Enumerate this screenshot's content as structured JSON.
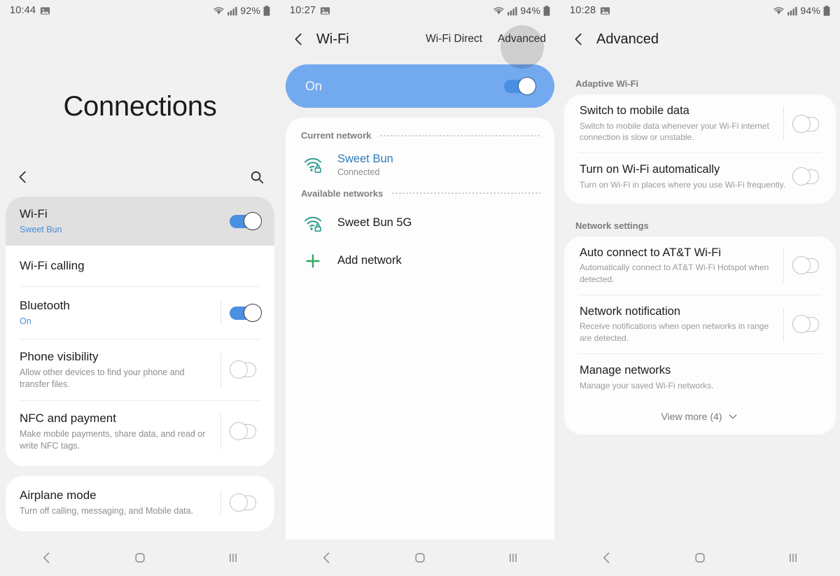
{
  "panels": {
    "left": {
      "status": {
        "time": "10:44",
        "battery": "92%",
        "icons": [
          "image-icon",
          "wifi-icon",
          "signal-icon",
          "battery-icon"
        ]
      },
      "page_title": "Connections",
      "tools": {
        "back": "back-chevron",
        "search": "search-icon"
      },
      "groups": [
        {
          "rows": [
            {
              "title": "Wi-Fi",
              "sub": "Sweet Bun",
              "sub_style": "blue",
              "toggle": "on",
              "selected": true,
              "divider_after": false
            },
            {
              "title": "Wi-Fi calling",
              "sub": "",
              "toggle": "none",
              "selected": false,
              "divider_after": true
            },
            {
              "title": "Bluetooth",
              "sub": "On",
              "sub_style": "blue",
              "toggle": "on",
              "selected": false,
              "divider_after": true
            },
            {
              "title": "Phone visibility",
              "sub": "Allow other devices to find your phone and transfer files.",
              "sub_style": "gray",
              "toggle": "off",
              "selected": false,
              "divider_after": true
            },
            {
              "title": "NFC and payment",
              "sub": "Make mobile payments, share data, and read or write NFC tags.",
              "sub_style": "gray",
              "toggle": "off",
              "selected": false,
              "divider_after": false
            }
          ]
        },
        {
          "rows": [
            {
              "title": "Airplane mode",
              "sub": "Turn off calling, messaging, and Mobile data.",
              "sub_style": "gray",
              "toggle": "off",
              "selected": false,
              "divider_after": false
            }
          ]
        }
      ],
      "navbar": [
        "back-nav-icon",
        "home-nav-icon",
        "recents-nav-icon"
      ]
    },
    "mid": {
      "status": {
        "time": "10:27",
        "battery": "94%"
      },
      "appbar": {
        "back": "back-chevron",
        "title": "Wi-Fi",
        "action1": "Wi-Fi Direct",
        "action2": "Advanced",
        "action2_pressed": true
      },
      "banner": {
        "label": "On",
        "toggle": "on"
      },
      "sections": [
        {
          "heading": "Current network",
          "items": [
            {
              "icon": "wifi-lock-icon",
              "title": "Sweet Bun",
              "sub": "Connected",
              "style": "linked"
            }
          ]
        },
        {
          "heading": "Available networks",
          "items": [
            {
              "icon": "wifi-lock-icon",
              "title": "Sweet Bun 5G",
              "sub": "",
              "style": "plain"
            },
            {
              "icon": "plus-icon",
              "title": "Add network",
              "sub": "",
              "style": "plain"
            }
          ]
        }
      ],
      "navbar": [
        "back-nav-icon",
        "home-nav-icon",
        "recents-nav-icon"
      ]
    },
    "right": {
      "status": {
        "time": "10:28",
        "battery": "94%"
      },
      "appbar": {
        "back": "back-chevron",
        "title": "Advanced"
      },
      "sections": [
        {
          "label": "Adaptive Wi-Fi",
          "rows": [
            {
              "title": "Switch to mobile data",
              "sub": "Switch to mobile data whenever your Wi-Fi internet connection is slow or unstable.",
              "toggle": "off",
              "divider_after": true
            },
            {
              "title": "Turn on Wi-Fi automatically",
              "sub": "Turn on Wi-Fi in places where you use Wi-Fi frequently.",
              "toggle": "off",
              "divider_after": false
            }
          ],
          "view_more": null
        },
        {
          "label": "Network settings",
          "rows": [
            {
              "title": "Auto connect to AT&T Wi-Fi",
              "sub": "Automatically connect to AT&T Wi-Fi Hotspot when detected.",
              "toggle": "off",
              "divider_after": true
            },
            {
              "title": "Network notification",
              "sub": "Receive notifications when open networks in range are detected.",
              "toggle": "off",
              "divider_after": true
            },
            {
              "title": "Manage networks",
              "sub": "Manage your saved Wi-Fi networks.",
              "toggle": "none",
              "divider_after": false
            }
          ],
          "view_more": "View more (4)"
        }
      ],
      "navbar": [
        "back-nav-icon",
        "home-nav-icon",
        "recents-nav-icon"
      ]
    }
  },
  "colors": {
    "accent_blue": "#4a90e2",
    "banner_blue": "#73a9ef",
    "link_blue": "#2f7dbb",
    "wifi_teal": "#2f9b8e",
    "plus_green": "#2fa85f",
    "page_bg": "#f1f1f1",
    "card_bg": "#ffffff"
  }
}
